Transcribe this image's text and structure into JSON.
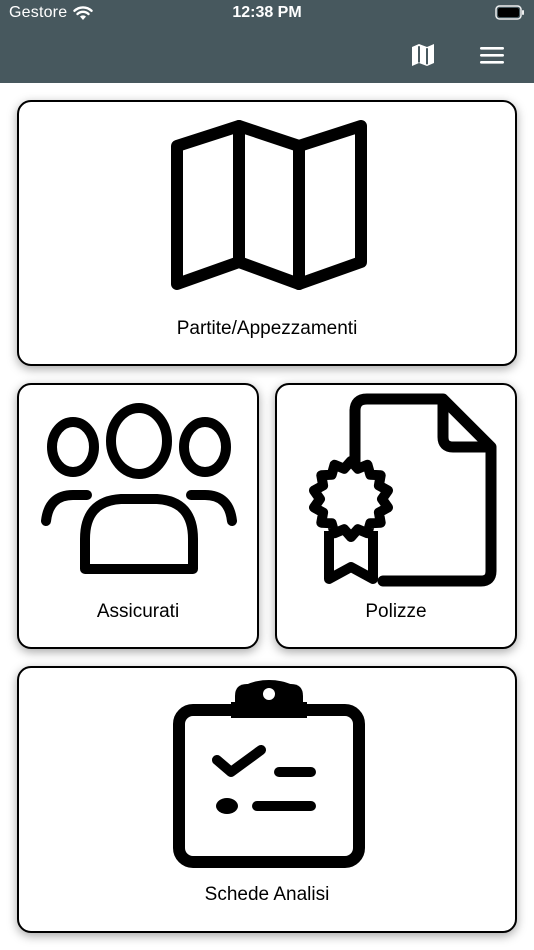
{
  "status_bar": {
    "carrier": "Gestore",
    "time": "12:38 PM",
    "icons": [
      "wifi-icon",
      "battery-icon"
    ]
  },
  "header": {
    "background": "#47585e",
    "actions": [
      {
        "name": "map-button",
        "icon": "map-icon"
      },
      {
        "name": "menu-button",
        "icon": "hamburger-menu-icon"
      }
    ]
  },
  "cards": {
    "partite": {
      "label": "Partite/Appezzamenti",
      "icon": "map-icon"
    },
    "assicurati": {
      "label": "Assicurati",
      "icon": "people-group-icon"
    },
    "polizze": {
      "label": "Polizze",
      "icon": "certificate-document-icon"
    },
    "schede": {
      "label": "Schede Analisi",
      "icon": "clipboard-checklist-icon"
    }
  }
}
